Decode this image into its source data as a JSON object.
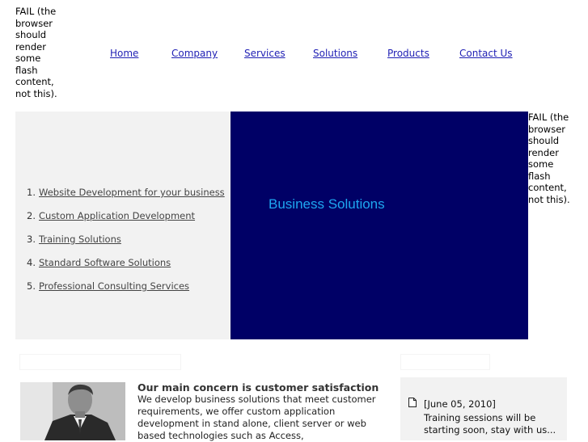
{
  "flash_fallback_top": "FAIL (the browser should render some flash content, not this).",
  "flash_fallback_right": "FAIL (the browser should render some flash content, not this).",
  "nav": {
    "items": [
      "Home",
      "Company",
      "Services",
      "Solutions",
      "Products",
      "Contact Us"
    ]
  },
  "left_menu": {
    "items": [
      {
        "num": "1.",
        "label": "Website Development for your business "
      },
      {
        "num": "2.",
        "label": "Custom Application Development "
      },
      {
        "num": "3.",
        "label": "Training Solutions "
      },
      {
        "num": "4.",
        "label": "Standard Software Solutions "
      },
      {
        "num": "5.",
        "label": "Professional Consulting Services "
      }
    ]
  },
  "banner": {
    "title": "Business Solutions",
    "bg_color": "#000066",
    "title_color": "#1ea7f0"
  },
  "about": {
    "title": "Our main concern is customer satisfaction",
    "text": "We develop business solutions that meet customer requirements, we offer custom application development in stand alone, client server or web based technologies such as Access,"
  },
  "news": {
    "date": "[June 05, 2010]",
    "text": "Training sessions will be starting soon, stay with us..."
  },
  "icons": {
    "news_item": "document-icon",
    "photo": "businessman-photo"
  }
}
